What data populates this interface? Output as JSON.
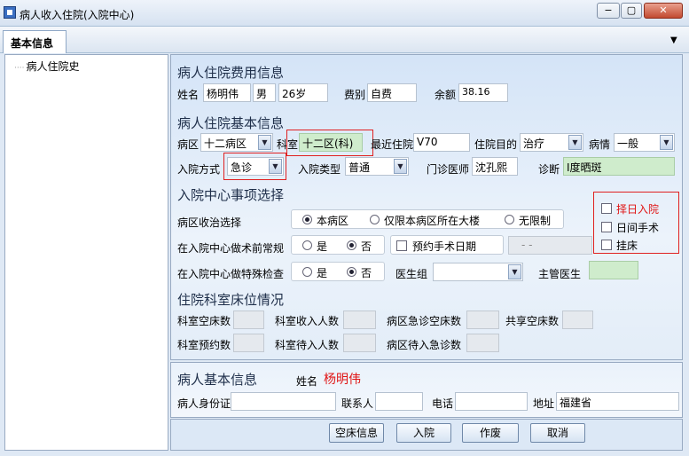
{
  "window": {
    "title": "病人收入住院(入院中心)",
    "min": "−",
    "max": "▢",
    "close": "✕"
  },
  "tab": {
    "label": "基本信息"
  },
  "tree": {
    "item": "病人住院史"
  },
  "fee": {
    "section": "病人住院费用信息",
    "name_label": "姓名",
    "name": "杨明伟",
    "sex": "男",
    "age": "26岁",
    "category_label": "费别",
    "category": "自费",
    "balance_label": "余额",
    "balance": "38.16"
  },
  "basic": {
    "section": "病人住院基本信息",
    "ward_label": "病区",
    "ward": "十二病区",
    "dept_label": "科室",
    "dept": "十二区(科)",
    "recent_label": "最近住院",
    "recent": "V70",
    "purpose_label": "住院目的",
    "purpose": "治疗",
    "condition_label": "病情",
    "condition": "一般",
    "mode_label": "入院方式",
    "mode": "急诊",
    "type_label": "入院类型",
    "type": "普通",
    "doctor_label": "门诊医师",
    "doctor": "沈孔熙",
    "diag_label": "诊断",
    "diag": "I度晒斑"
  },
  "center": {
    "section": "入院中心事项选择",
    "ward_select_label": "病区收治选择",
    "opt_this": "本病区",
    "opt_building": "仅限本病区所在大楼",
    "opt_unlimited": "无限制",
    "routine_label": "在入院中心做术前常规",
    "yes": "是",
    "no": "否",
    "surgery_date_label": "预约手术日期",
    "surgery_date": "-   -",
    "special_label": "在入院中心做特殊检查",
    "group_label": "医生组",
    "group": "",
    "chief_label": "主管医生",
    "chief": "",
    "chk_date": "择日入院",
    "chk_day": "日间手术",
    "chk_bed": "挂床"
  },
  "beds": {
    "section": "住院科室床位情况",
    "dept_empty": "科室空床数",
    "dept_admit": "科室收入人数",
    "ward_emergency": "病区急诊空床数",
    "shared_empty": "共享空床数",
    "dept_reserve": "科室预约数",
    "dept_waiting": "科室待入人数",
    "ward_waiting": "病区待入急诊数"
  },
  "patient": {
    "section": "病人基本信息",
    "name_label": "姓名",
    "name": "杨明伟",
    "id_label": "病人身份证",
    "id": "",
    "contact_label": "联系人",
    "contact": "",
    "phone_label": "电话",
    "phone": "",
    "address_label": "地址",
    "address": "福建省"
  },
  "buttons": {
    "beds": "空床信息",
    "admit": "入院",
    "void": "作废",
    "cancel": "取消"
  }
}
